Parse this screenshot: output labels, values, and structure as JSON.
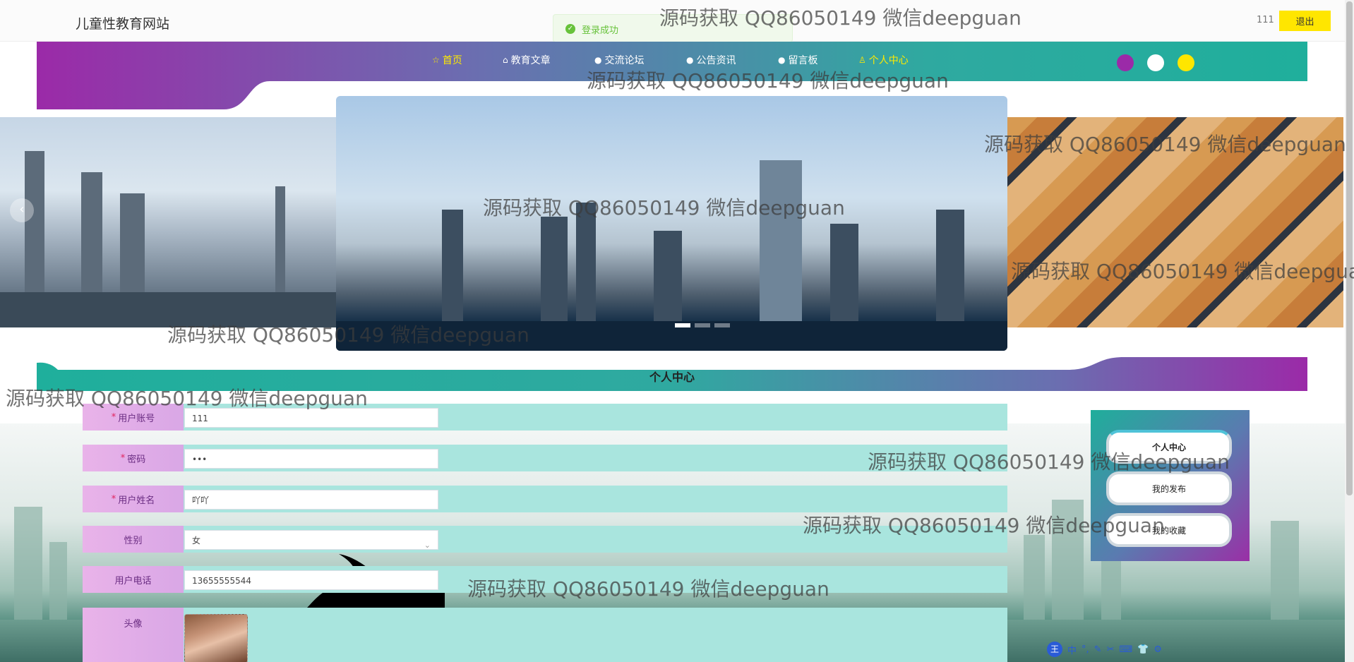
{
  "site": {
    "title": "儿童性教育网站"
  },
  "user": {
    "name": "111",
    "logout_label": "退出"
  },
  "toast": {
    "message": "登录成功"
  },
  "nav": {
    "items": [
      {
        "label": "首页",
        "icon": "star-icon",
        "active": true
      },
      {
        "label": "教育文章",
        "icon": "bag-icon"
      },
      {
        "label": "交流论坛",
        "icon": "info-icon"
      },
      {
        "label": "公告资讯",
        "icon": "info-icon"
      },
      {
        "label": "留言板",
        "icon": "help-icon"
      },
      {
        "label": "个人中心",
        "icon": "user-icon"
      }
    ],
    "theme_colors": [
      "#9b2aa8",
      "#ffffff",
      "#ffe600"
    ]
  },
  "carousel": {
    "prev_label": "‹",
    "indicator_count": 3,
    "active_index": 0
  },
  "section": {
    "title": "个人中心"
  },
  "form": {
    "fields": [
      {
        "label": "用户账号",
        "required": true,
        "value": "111"
      },
      {
        "label": "密码",
        "required": true,
        "value": "•••"
      },
      {
        "label": "用户姓名",
        "required": true,
        "value": "吖吖"
      },
      {
        "label": "性别",
        "required": false,
        "value": "女"
      },
      {
        "label": "用户电话",
        "required": false,
        "value": "13655555544"
      },
      {
        "label": "头像",
        "required": false
      }
    ]
  },
  "side_menu": {
    "items": [
      {
        "label": "个人中心",
        "active": true
      },
      {
        "label": "我的发布"
      },
      {
        "label": "我的收藏"
      }
    ]
  },
  "ime": {
    "items": [
      "王",
      "中",
      "°,",
      "✎",
      "✂",
      "⌨",
      "👕",
      "⚙"
    ]
  },
  "watermark": {
    "text": "源码获取 QQ86050149 微信deepguan"
  }
}
